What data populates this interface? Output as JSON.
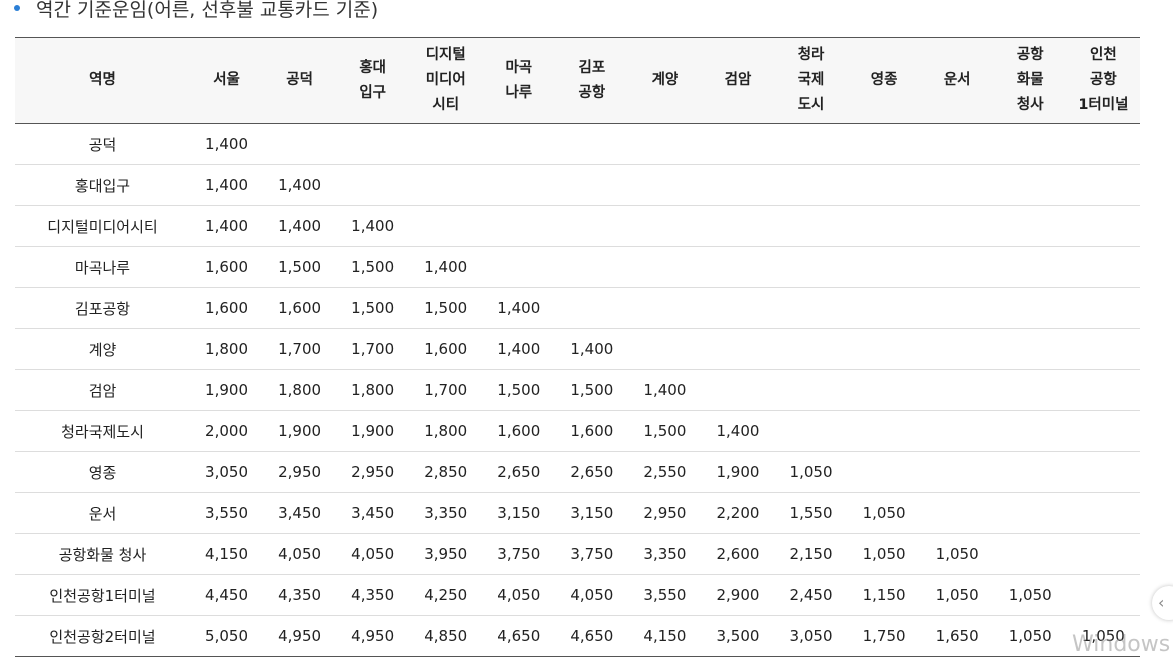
{
  "heading": {
    "text": "역간 기준운임(어른, 선후불 교통카드 기준)",
    "bullet_color": "#2b7fd6"
  },
  "table": {
    "header": [
      [
        "역명"
      ],
      [
        "서울"
      ],
      [
        "공덕"
      ],
      [
        "홍대",
        "입구"
      ],
      [
        "디지털",
        "미디어",
        "시티"
      ],
      [
        "마곡",
        "나루"
      ],
      [
        "김포",
        "공항"
      ],
      [
        "계양"
      ],
      [
        "검암"
      ],
      [
        "청라",
        "국제",
        "도시"
      ],
      [
        "영종"
      ],
      [
        "운서"
      ],
      [
        "공항",
        "화물",
        "청사"
      ],
      [
        "인천",
        "공항",
        "1터미널"
      ]
    ],
    "rows": [
      {
        "station": "공덕",
        "fares": [
          "1,400"
        ]
      },
      {
        "station": "홍대입구",
        "fares": [
          "1,400",
          "1,400"
        ]
      },
      {
        "station": "디지털미디어시티",
        "fares": [
          "1,400",
          "1,400",
          "1,400"
        ]
      },
      {
        "station": "마곡나루",
        "fares": [
          "1,600",
          "1,500",
          "1,500",
          "1,400"
        ]
      },
      {
        "station": "김포공항",
        "fares": [
          "1,600",
          "1,600",
          "1,500",
          "1,500",
          "1,400"
        ]
      },
      {
        "station": "계양",
        "fares": [
          "1,800",
          "1,700",
          "1,700",
          "1,600",
          "1,400",
          "1,400"
        ]
      },
      {
        "station": "검암",
        "fares": [
          "1,900",
          "1,800",
          "1,800",
          "1,700",
          "1,500",
          "1,500",
          "1,400"
        ]
      },
      {
        "station": "청라국제도시",
        "fares": [
          "2,000",
          "1,900",
          "1,900",
          "1,800",
          "1,600",
          "1,600",
          "1,500",
          "1,400"
        ]
      },
      {
        "station": "영종",
        "fares": [
          "3,050",
          "2,950",
          "2,950",
          "2,850",
          "2,650",
          "2,650",
          "2,550",
          "1,900",
          "1,050"
        ]
      },
      {
        "station": "운서",
        "fares": [
          "3,550",
          "3,450",
          "3,450",
          "3,350",
          "3,150",
          "3,150",
          "2,950",
          "2,200",
          "1,550",
          "1,050"
        ]
      },
      {
        "station": "공항화물 청사",
        "fares": [
          "4,150",
          "4,050",
          "4,050",
          "3,950",
          "3,750",
          "3,750",
          "3,350",
          "2,600",
          "2,150",
          "1,050",
          "1,050"
        ]
      },
      {
        "station": "인천공항1터미널",
        "fares": [
          "4,450",
          "4,350",
          "4,350",
          "4,250",
          "4,050",
          "4,050",
          "3,550",
          "2,900",
          "2,450",
          "1,150",
          "1,050",
          "1,050"
        ]
      },
      {
        "station": "인천공항2터미널",
        "fares": [
          "5,050",
          "4,950",
          "4,950",
          "4,850",
          "4,650",
          "4,650",
          "4,150",
          "3,500",
          "3,050",
          "1,750",
          "1,650",
          "1,050",
          "1,050"
        ]
      }
    ]
  },
  "watermark": "Windows",
  "edge_icon": "chevron-left-icon"
}
